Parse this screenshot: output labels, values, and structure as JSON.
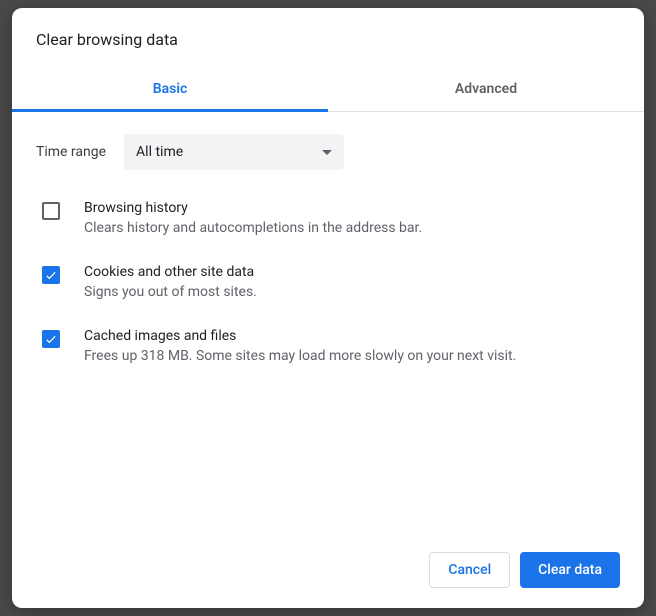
{
  "dialog": {
    "title": "Clear browsing data",
    "tabs": {
      "basic": "Basic",
      "advanced": "Advanced"
    },
    "time_range": {
      "label": "Time range",
      "value": "All time"
    },
    "options": [
      {
        "checked": false,
        "title": "Browsing history",
        "desc": "Clears history and autocompletions in the address bar."
      },
      {
        "checked": true,
        "title": "Cookies and other site data",
        "desc": "Signs you out of most sites."
      },
      {
        "checked": true,
        "title": "Cached images and files",
        "desc": "Frees up 318 MB. Some sites may load more slowly on your next visit."
      }
    ],
    "buttons": {
      "cancel": "Cancel",
      "confirm": "Clear data"
    }
  }
}
